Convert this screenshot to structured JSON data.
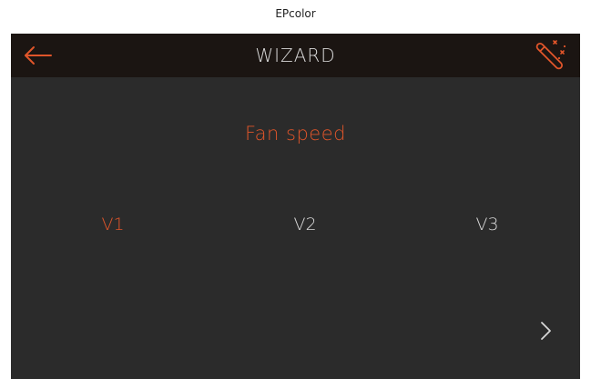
{
  "window": {
    "title": "EPcolor"
  },
  "header": {
    "title": "WIZARD",
    "back_icon": "arrow-left-icon",
    "wizard_icon": "magic-wand-icon"
  },
  "main": {
    "section_title": "Fan speed",
    "options": [
      {
        "label": "V1",
        "selected": true
      },
      {
        "label": "V2",
        "selected": false
      },
      {
        "label": "V3",
        "selected": false
      }
    ],
    "next_icon": "chevron-right-icon"
  },
  "colors": {
    "accent": "#e0552a",
    "background": "#2b2b2b",
    "header_background": "#1b1512",
    "text": "#d8d8d8"
  }
}
